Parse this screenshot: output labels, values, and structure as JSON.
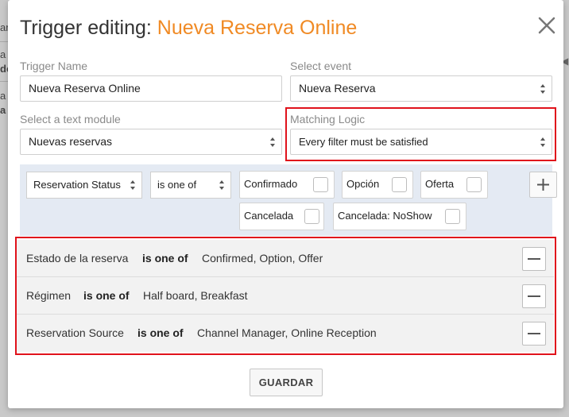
{
  "background": {
    "fragments": [
      "ar",
      "a",
      "do",
      "a",
      "a"
    ]
  },
  "modal": {
    "title_prefix": "Trigger editing: ",
    "title_name": "Nueva Reserva Online",
    "accent_color": "#f08a24",
    "highlight_color": "#e0121b"
  },
  "form": {
    "trigger_name": {
      "label": "Trigger Name",
      "value": "Nueva Reserva Online"
    },
    "select_event": {
      "label": "Select event",
      "value": "Nueva Reserva"
    },
    "text_module": {
      "label": "Select a text module",
      "value": "Nuevas reservas"
    },
    "matching_logic": {
      "label": "Matching Logic",
      "value": "Every filter must be satisfied"
    }
  },
  "filter": {
    "field_select": "Reservation Status",
    "operator_select": "is one of",
    "options": [
      {
        "label": "Confirmado",
        "checked": false
      },
      {
        "label": "Opción",
        "checked": false
      },
      {
        "label": "Oferta",
        "checked": false
      },
      {
        "label": "Cancelada",
        "checked": false
      },
      {
        "label": "Cancelada: NoShow",
        "checked": false
      }
    ],
    "add_icon": "plus-icon"
  },
  "rules": [
    {
      "field": "Estado de la reserva",
      "operator": "is one of",
      "values": "Confirmed, Option, Offer"
    },
    {
      "field": "Régimen",
      "operator": "is one of",
      "values": "Half board, Breakfast"
    },
    {
      "field": "Reservation Source",
      "operator": "is one of",
      "values": "Channel Manager, Online Reception"
    }
  ],
  "actions": {
    "save_label": "GUARDAR"
  }
}
